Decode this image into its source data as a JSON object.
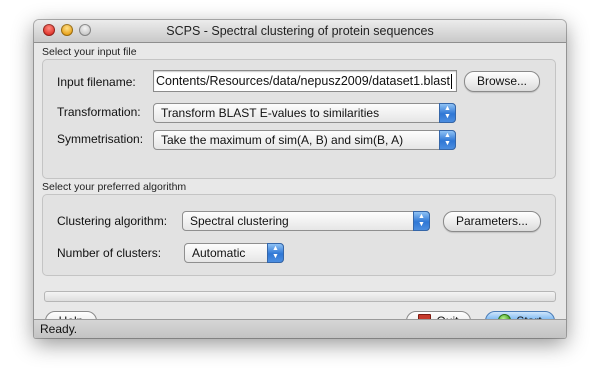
{
  "window": {
    "title": "SCPS - Spectral clustering of protein sequences"
  },
  "input_section": {
    "heading": "Select your input file",
    "filename_label": "Input filename:",
    "filename_value": "Contents/Resources/data/nepusz2009/dataset1.blast",
    "browse_label": "Browse...",
    "transformation_label": "Transformation:",
    "transformation_value": "Transform BLAST E-values to similarities",
    "symmetrisation_label": "Symmetrisation:",
    "symmetrisation_value": "Take the maximum of sim(A, B) and sim(B, A)"
  },
  "algorithm_section": {
    "heading": "Select your preferred algorithm",
    "algorithm_label": "Clustering algorithm:",
    "algorithm_value": "Spectral clustering",
    "parameters_label": "Parameters...",
    "clusters_label": "Number of clusters:",
    "clusters_value": "Automatic"
  },
  "progress": {
    "value": 0
  },
  "buttons": {
    "help": "Help",
    "quit": "Quit",
    "start": "Start"
  },
  "status": {
    "text": "Ready."
  },
  "icons": {
    "quit": "stop-icon",
    "start": "go-icon"
  },
  "colors": {
    "accent": "#2f77d5",
    "window_bg": "#e8e8e8"
  }
}
